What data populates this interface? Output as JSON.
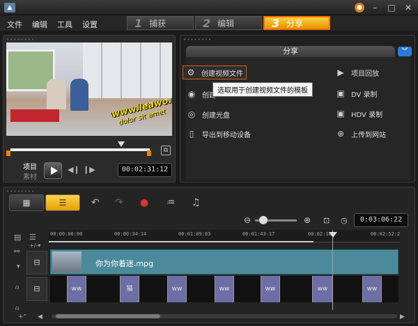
{
  "menu": {
    "file": "文件",
    "edit": "编辑",
    "tools": "工具",
    "settings": "设置"
  },
  "steps": [
    {
      "num": "1",
      "label": "捕获"
    },
    {
      "num": "2",
      "label": "编辑"
    },
    {
      "num": "3",
      "label": "分享"
    }
  ],
  "preview": {
    "watermark": "www.leawo.cn",
    "watermark_sub": "dolor sit amet",
    "mode_project": "项目",
    "mode_clip": "素材",
    "timecode": "00:02:31:12"
  },
  "share": {
    "title": "分享",
    "items_left": [
      {
        "icon": "film-reel-icon",
        "label": "创建视频文件"
      },
      {
        "icon": "audio-disc-icon",
        "label": "创建"
      },
      {
        "icon": "disc-icon",
        "label": "创建光盘"
      },
      {
        "icon": "mobile-device-icon",
        "label": "导出到移动设备"
      }
    ],
    "items_right": [
      {
        "icon": "project-playback-icon",
        "label": "项目回放"
      },
      {
        "icon": "dv-camera-icon",
        "label": "DV 录制"
      },
      {
        "icon": "hdv-camera-icon",
        "label": "HDV 录制"
      },
      {
        "icon": "globe-icon",
        "label": "上传到网站"
      }
    ],
    "tooltip": "选取用于创建视频文件的模板"
  },
  "timeline": {
    "timecode": "0:03:06:22",
    "ruler": [
      "00:00:00:00",
      "00:00:34:14",
      "00:01:09:03",
      "00:01:43:17",
      "00:02:18:",
      "00:02:52:2"
    ],
    "clip_name": "你为你着迷.mpg",
    "overlay_marks": [
      "ww",
      "猫",
      "ww",
      "ww",
      "ww",
      "ww",
      "ww"
    ]
  }
}
